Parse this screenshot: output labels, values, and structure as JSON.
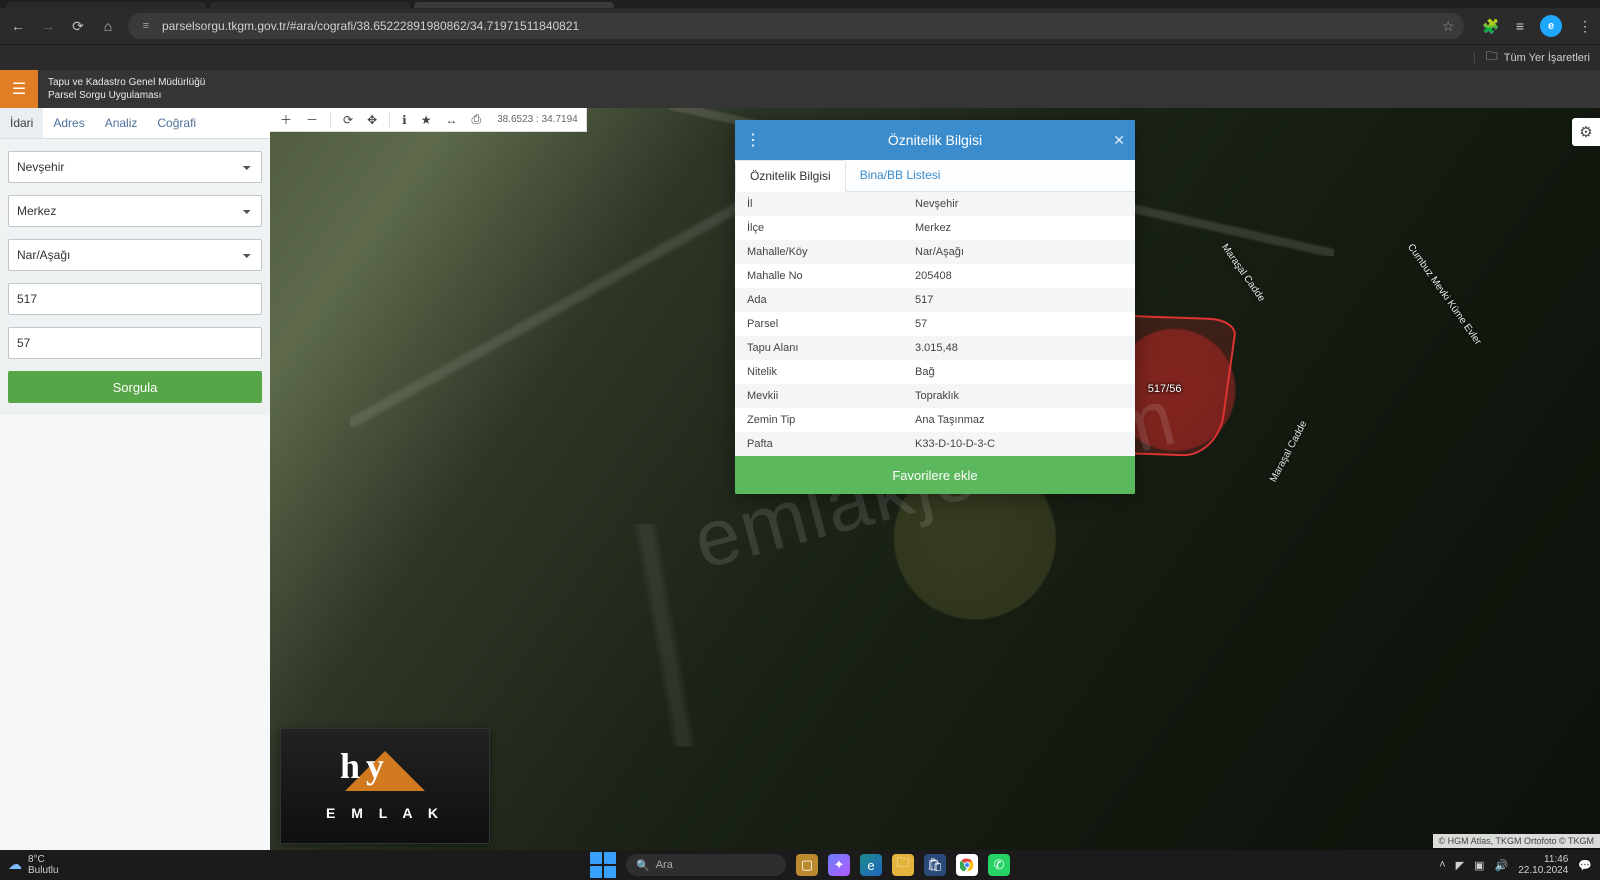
{
  "browser": {
    "url": "parselsorgu.tkgm.gov.tr/#ara/cografi/38.65222891980862/34.71971511840821",
    "bookmark_label": "Tüm Yer İşaretleri",
    "avatar_initial": "e"
  },
  "app": {
    "org": "Tapu ve Kadastro Genel Müdürlüğü",
    "title": "Parsel Sorgu Uygulaması"
  },
  "left": {
    "tabs": {
      "idari": "İdari",
      "adres": "Adres",
      "analiz": "Analiz",
      "cografi": "Coğrafi"
    },
    "il": "Nevşehir",
    "ilce": "Merkez",
    "mahalle": "Nar/Aşağı",
    "ada": "517",
    "parsel": "57",
    "query_btn": "Sorgula"
  },
  "toolbar": {
    "zoom_in": "plus-icon",
    "zoom_out": "minus-icon",
    "refresh": "refresh-icon",
    "pan": "move-icon",
    "info": "info-icon",
    "fav": "star-icon",
    "ruler": "ruler-icon",
    "print": "print-icon",
    "coords": "38.6523 : 34.7194"
  },
  "popup": {
    "title": "Öznitelik Bilgisi",
    "tab_attr": "Öznitelik Bilgisi",
    "tab_bina": "Bina/BB Listesi",
    "rows": [
      {
        "k": "İl",
        "v": "Nevşehir"
      },
      {
        "k": "İlçe",
        "v": "Merkez"
      },
      {
        "k": "Mahalle/Köy",
        "v": "Nar/Aşağı"
      },
      {
        "k": "Mahalle No",
        "v": "205408"
      },
      {
        "k": "Ada",
        "v": "517"
      },
      {
        "k": "Parsel",
        "v": "57"
      },
      {
        "k": "Tapu Alanı",
        "v": "3.015,48"
      },
      {
        "k": "Nitelik",
        "v": "Bağ"
      },
      {
        "k": "Mevkii",
        "v": "Topraklık"
      },
      {
        "k": "Zemin Tip",
        "v": "Ana Taşınmaz"
      },
      {
        "k": "Pafta",
        "v": "K33-D-10-D-3-C"
      }
    ],
    "fav_btn": "Favorilere ekle"
  },
  "map": {
    "parcel_label": "517/56",
    "road1": "Maraşal Cadde",
    "road2": "Maraşal Cadde",
    "road3": "Cumbuz Mevki Küme Evler",
    "watermark": "emlakjet.com",
    "logo_text": "E M L A K",
    "attribution": "© HGM Atlas, TKGM Ortofoto © TKGM"
  },
  "taskbar": {
    "weather_temp": "8°C",
    "weather_desc": "Bulutlu",
    "search_placeholder": "Ara",
    "time": "11:46",
    "date": "22.10.2024"
  }
}
